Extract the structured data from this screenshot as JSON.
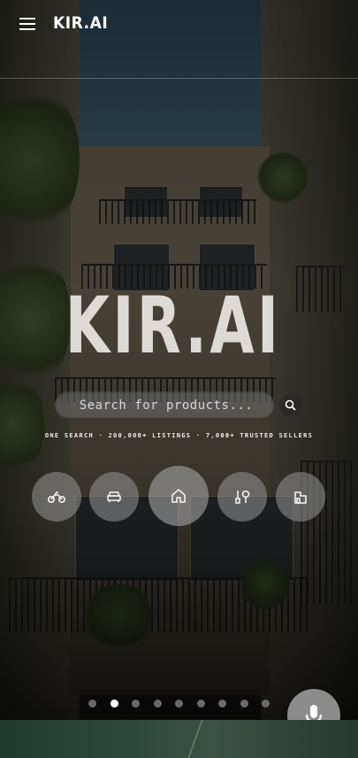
{
  "header": {
    "logo": "KIR.AI",
    "menu_icon": "hamburger-menu-icon"
  },
  "hero": {
    "title": "KIR.AI",
    "search_placeholder": "Search for products...",
    "search_icon": "search-icon",
    "tagline": "ONE SEARCH · 200,000+ LISTINGS · 7,000+ TRUSTED SELLERS"
  },
  "categories": [
    {
      "id": "motorcycles",
      "icon": "motorcycle-icon",
      "active": false
    },
    {
      "id": "cars",
      "icon": "car-icon",
      "active": false
    },
    {
      "id": "real-estate",
      "icon": "home-icon",
      "active": true
    },
    {
      "id": "services",
      "icon": "tools-icon",
      "active": false
    },
    {
      "id": "commercial",
      "icon": "building-icon",
      "active": false
    }
  ],
  "carousel": {
    "slide_count": 9,
    "active_index": 1
  },
  "voice": {
    "icon": "microphone-icon"
  },
  "colors": {
    "dot_active": "#ffffff",
    "dot_inactive": "#6a6a6a",
    "mic_bg": "#8c8c8c",
    "bottom_strip": "#2e4a3d"
  }
}
